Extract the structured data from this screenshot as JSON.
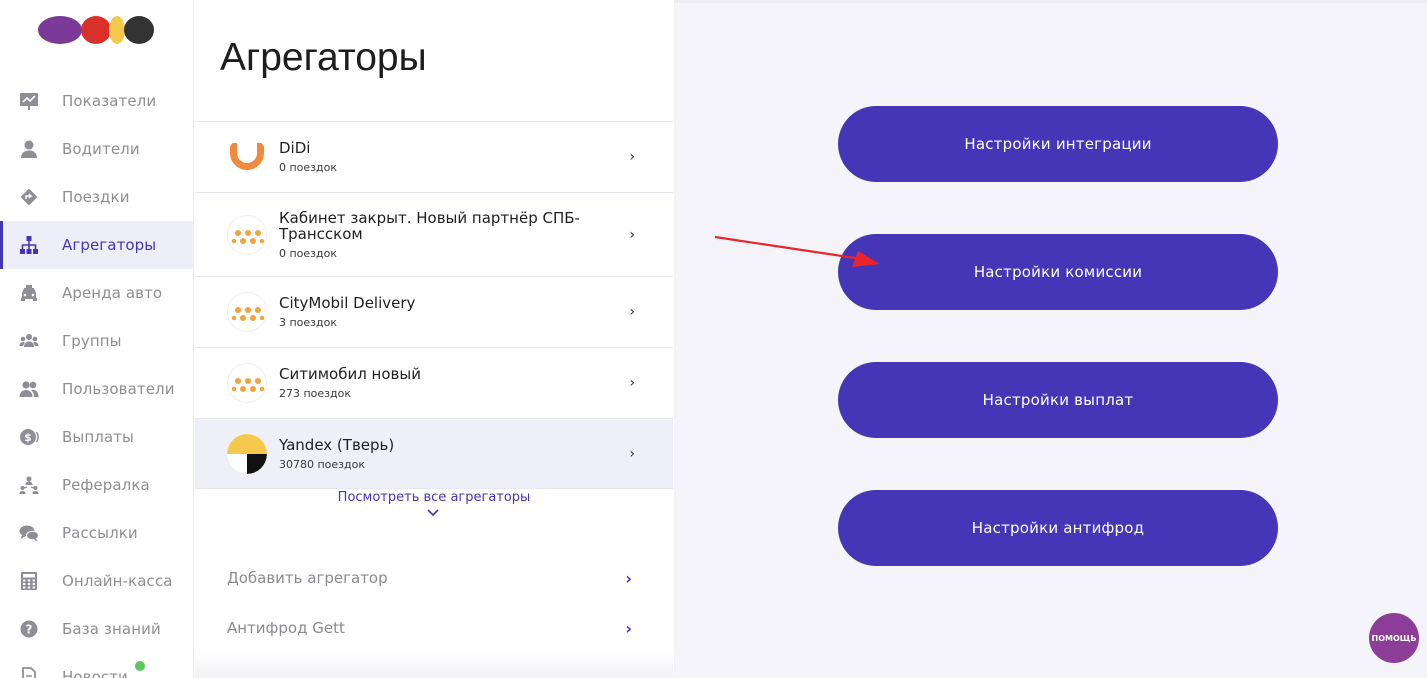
{
  "colors": {
    "accent": "#4535b7",
    "sidebar_active_bg": "#eeeef8",
    "right_bg": "#f4f4fa",
    "help": "#8b3d98",
    "arrow": "#e8242c",
    "logo_purple": "#7b3a97",
    "logo_red": "#d9302a",
    "logo_yellow": "#f3c84b",
    "logo_dark": "#333333"
  },
  "sidebar": {
    "items": [
      {
        "label": "Показатели",
        "icon": "chart-board-icon"
      },
      {
        "label": "Водители",
        "icon": "person-icon"
      },
      {
        "label": "Поездки",
        "icon": "route-diamond-icon"
      },
      {
        "label": "Агрегаторы",
        "icon": "hierarchy-icon",
        "active": true
      },
      {
        "label": "Аренда авто",
        "icon": "taxi-car-icon"
      },
      {
        "label": "Группы",
        "icon": "group-icon"
      },
      {
        "label": "Пользователи",
        "icon": "users-icon"
      },
      {
        "label": "Выплаты",
        "icon": "dollar-coin-icon"
      },
      {
        "label": "Рефералка",
        "icon": "referral-icon"
      },
      {
        "label": "Рассылки",
        "icon": "chat-bubbles-icon"
      },
      {
        "label": "Онлайн-касса",
        "icon": "calculator-icon"
      },
      {
        "label": "База знаний",
        "icon": "question-circle-icon"
      },
      {
        "label": "Новости",
        "icon": "document-icon"
      }
    ]
  },
  "main": {
    "title": "Агрегаторы",
    "aggregators": [
      {
        "name": "DiDi",
        "trips": "0 поездок",
        "logo": "didi-logo"
      },
      {
        "name": "Кабинет закрыт. Новый партнёр СПБ-Трансском",
        "trips": "0 поездок",
        "logo": "taxi-dots-logo"
      },
      {
        "name": "CityMobil Delivery",
        "trips": "3 поездок",
        "logo": "taxi-dots-logo"
      },
      {
        "name": "Ситимобил новый",
        "trips": "273 поездок",
        "logo": "taxi-dots-logo"
      },
      {
        "name": "Yandex (Тверь)",
        "trips": "30780 поездок",
        "logo": "yandex-logo",
        "selected": true
      }
    ],
    "see_all": "Посмотреть все агрегаторы",
    "add_aggregator": "Добавить агрегатор",
    "antifraud_gett": "Антифрод Gett"
  },
  "settings": {
    "integration": "Настройки интеграции",
    "commission": "Настройки комиссии",
    "payouts": "Настройки выплат",
    "antifraud": "Настройки антифрод"
  },
  "help": {
    "label": "ПОМОЩЬ"
  }
}
